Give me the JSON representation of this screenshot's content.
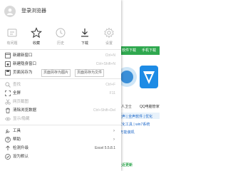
{
  "background": {
    "tabs": [
      "软件下载",
      "手机下载"
    ],
    "tile_caption": "QQ电脑管家",
    "caption_left": "人卫士",
    "rows": [
      "全声 | 全声软件 | 优化",
      "优化工具 | win7系统",
      "| 万能装机"
    ],
    "bottom": "社近更新"
  },
  "menu": {
    "login": "登录浏览器",
    "icons": [
      {
        "name": "history",
        "label": "有问题"
      },
      {
        "name": "star",
        "label": "收藏"
      },
      {
        "name": "clock",
        "label": "历史"
      },
      {
        "name": "download",
        "label": "下载"
      },
      {
        "name": "gear",
        "label": "设置"
      }
    ],
    "items": [
      {
        "label": "新建新窗口",
        "key": "Ctrl+N",
        "icon": "new-window",
        "disabled": false
      },
      {
        "label": "新建隐身窗口",
        "key": "Ctrl+Shift+N",
        "icon": "incognito",
        "disabled": false
      },
      {
        "label": "页面另存为",
        "icon": "save",
        "disabled": false,
        "tags": [
          "页面另存为图片",
          "页面另存为文件"
        ]
      },
      {
        "label": "查找",
        "key": "Ctrl+F",
        "icon": "search",
        "disabled": true
      },
      {
        "label": "全屏",
        "key": "F11",
        "icon": "fullscreen",
        "disabled": false
      },
      {
        "label": "网页截图",
        "key": "",
        "icon": "scissors",
        "disabled": true
      },
      {
        "label": "清除浏览数据",
        "key": "Ctrl+Shift+Del",
        "icon": "trash",
        "disabled": false
      },
      {
        "label": "显示/隐藏",
        "key": "",
        "icon": "eye",
        "disabled": true
      },
      {
        "label": "工具",
        "key": "",
        "icon": "tool",
        "disabled": false,
        "submenu": true
      },
      {
        "label": "帮助",
        "key": "",
        "icon": "help",
        "disabled": false,
        "submenu": true
      },
      {
        "label": "检测升级",
        "key": "Excel 5.5.8.1",
        "icon": "upgrade",
        "disabled": false
      },
      {
        "label": "设为默认",
        "key": "",
        "icon": "default",
        "disabled": false
      }
    ]
  },
  "colors": {
    "accent": "#2fa84f",
    "link": "#1a66c8"
  }
}
